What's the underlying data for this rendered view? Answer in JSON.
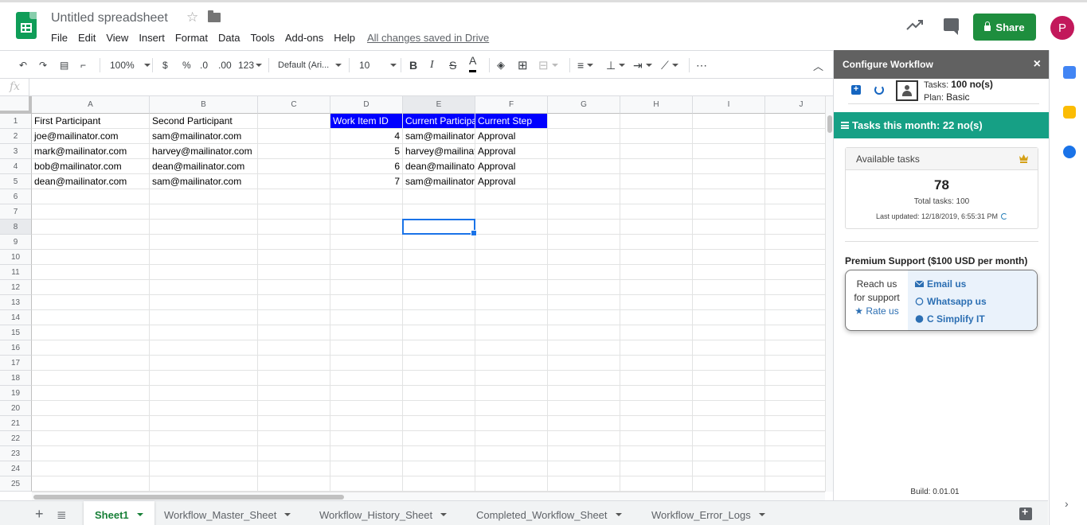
{
  "header": {
    "doc_title": "Untitled spreadsheet",
    "menu": [
      "File",
      "Edit",
      "View",
      "Insert",
      "Format",
      "Data",
      "Tools",
      "Add-ons",
      "Help"
    ],
    "saved_status": "All changes saved in Drive",
    "share_label": "Share",
    "avatar_letter": "P",
    "colors": {
      "share_bg": "#1e8e3e",
      "avatar_bg": "#c2185b",
      "logo": "#0f9d58"
    }
  },
  "toolbar": {
    "zoom": "100%",
    "currency": "$",
    "percent": "%",
    "decimal_dec": ".0",
    "decimal_inc": ".00",
    "number_format": "123",
    "font": "Default (Ari...",
    "font_size": "10",
    "bold": "B",
    "italic": "I",
    "strike": "S",
    "text_color": "A",
    "more": "⋯"
  },
  "formula_bar": {
    "fx": "fx",
    "value": ""
  },
  "grid": {
    "columns": [
      "A",
      "B",
      "C",
      "D",
      "E",
      "F",
      "G",
      "H",
      "I",
      "J"
    ],
    "selected_column": "E",
    "selected_row": 8,
    "rows": [
      [
        "First Participant",
        "Second Participant",
        "",
        "Work Item ID",
        "Current Participant",
        "Current Step",
        "",
        "",
        "",
        ""
      ],
      [
        "joe@mailinator.com",
        "sam@mailinator.com",
        "",
        "4",
        "sam@mailinator.com",
        "Approval",
        "",
        "",
        "",
        ""
      ],
      [
        "mark@mailinator.com",
        "harvey@mailinator.com",
        "",
        "5",
        "harvey@mailinator.com",
        "Approval",
        "",
        "",
        "",
        ""
      ],
      [
        "bob@mailinator.com",
        "dean@mailinator.com",
        "",
        "6",
        "dean@mailinator.com",
        "Approval",
        "",
        "",
        "",
        ""
      ],
      [
        "dean@mailinator.com",
        "sam@mailinator.com",
        "",
        "7",
        "sam@mailinator.com",
        "Approval",
        "",
        "",
        "",
        ""
      ]
    ],
    "row_count": 25,
    "header_highlight_color": "#0000ff"
  },
  "sheet_tabs": [
    {
      "label": "Sheet1",
      "active": true
    },
    {
      "label": "Workflow_Master_Sheet",
      "active": false
    },
    {
      "label": "Workflow_History_Sheet",
      "active": false
    },
    {
      "label": "Completed_Workflow_Sheet",
      "active": false
    },
    {
      "label": "Workflow_Error_Logs",
      "active": false
    }
  ],
  "panel": {
    "title": "Configure Workflow",
    "close": "×",
    "tasks_label": "Tasks:",
    "tasks_value": "100 no(s)",
    "plan_label": "Plan:",
    "plan_value": "Basic",
    "month_banner": "Tasks this month: 22 no(s)",
    "available_title": "Available tasks",
    "available_count": "78",
    "total_tasks": "Total tasks: 100",
    "last_updated": "Last updated: 12/18/2019, 6:55:31 PM",
    "premium_title": "Premium Support ($100 USD per month)",
    "reach_line1": "Reach us",
    "reach_line2": "for support",
    "rate_us": "Rate us",
    "links": [
      "Email us",
      "Whatsapp us",
      "C Simplify IT"
    ],
    "build": "Build: 0.01.01",
    "colors": {
      "header": "#616161",
      "banner": "#16a085",
      "link": "#2c6fb3"
    }
  }
}
